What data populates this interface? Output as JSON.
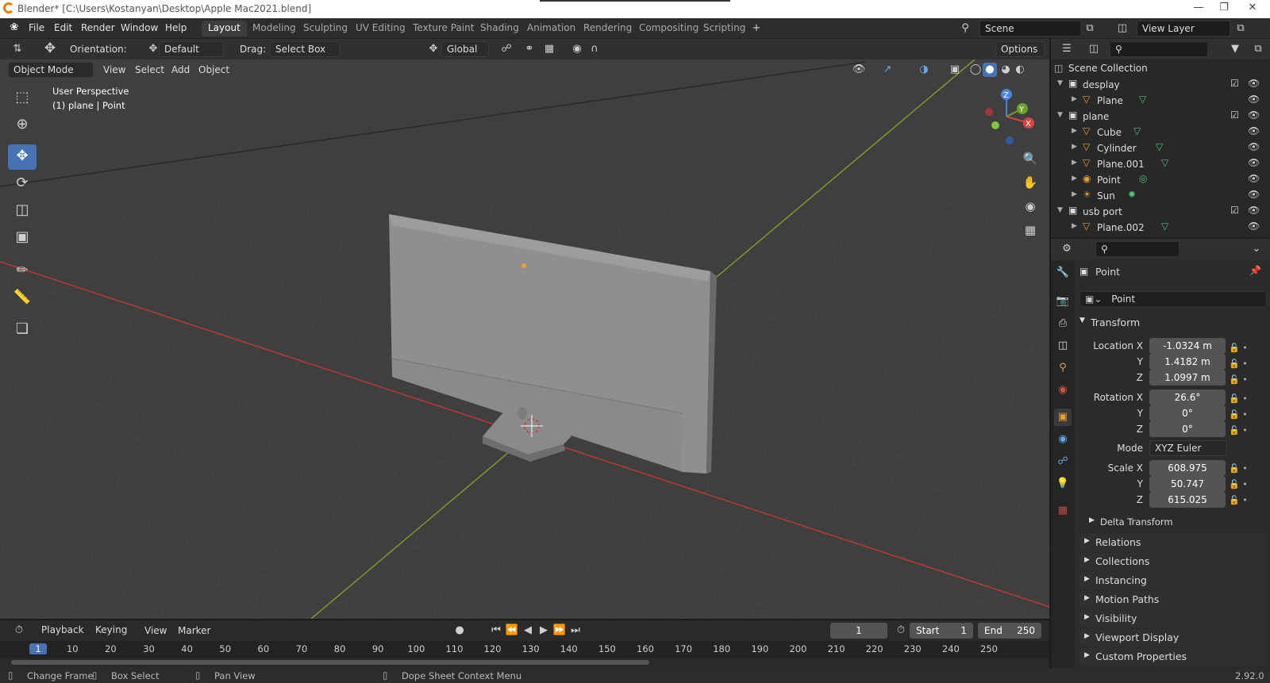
{
  "window": {
    "title": "Blender* [C:\\Users\\Kostanyan\\Desktop\\Apple Mac2021.blend]"
  },
  "menu": [
    "File",
    "Edit",
    "Render",
    "Window",
    "Help"
  ],
  "workspaces": [
    "Layout",
    "Modeling",
    "Sculpting",
    "UV Editing",
    "Texture Paint",
    "Shading",
    "Animation",
    "Rendering",
    "Compositing",
    "Scripting"
  ],
  "scene": {
    "label": "Scene",
    "view_layer": "View Layer"
  },
  "header": {
    "orientation_label": "Orientation:",
    "orientation": "Default",
    "drag_label": "Drag:",
    "drag": "Select Box",
    "transform": "Global",
    "options": "Options"
  },
  "vp_header": {
    "mode": "Object Mode",
    "menus": [
      "View",
      "Select",
      "Add",
      "Object"
    ]
  },
  "viewport": {
    "perspective": "User Perspective",
    "object_info": "(1) plane | Point"
  },
  "gizmo": {
    "x": "X",
    "y": "Y",
    "z": "Z"
  },
  "outliner": {
    "root": "Scene Collection",
    "rows": [
      {
        "name": "desplay",
        "kind": "collection",
        "depth": 1
      },
      {
        "name": "Plane",
        "kind": "mesh",
        "depth": 2
      },
      {
        "name": "plane",
        "kind": "collection",
        "depth": 1
      },
      {
        "name": "Cube",
        "kind": "mesh",
        "depth": 2
      },
      {
        "name": "Cylinder",
        "kind": "mesh",
        "depth": 2
      },
      {
        "name": "Plane.001",
        "kind": "mesh",
        "depth": 2
      },
      {
        "name": "Point",
        "kind": "light",
        "depth": 2
      },
      {
        "name": "Sun",
        "kind": "sun",
        "depth": 2
      },
      {
        "name": "usb port",
        "kind": "collection",
        "depth": 1
      },
      {
        "name": "Plane.002",
        "kind": "mesh",
        "depth": 2
      }
    ]
  },
  "properties": {
    "object_name": "Point",
    "datablock": "Point",
    "transform_label": "Transform",
    "location_label": "Location X",
    "location": [
      "-1.0324 m",
      "1.4182 m",
      "1.0997 m"
    ],
    "rotation_label": "Rotation X",
    "rotation": [
      "26.6°",
      "0°",
      "0°"
    ],
    "mode_label": "Mode",
    "mode": "XYZ Euler",
    "scale_label": "Scale X",
    "scale": [
      "608.975",
      "50.747",
      "615.025"
    ],
    "axis_y": "Y",
    "axis_z": "Z",
    "delta": "Delta Transform",
    "panels": [
      "Relations",
      "Collections",
      "Instancing",
      "Motion Paths",
      "Visibility",
      "Viewport Display",
      "Custom Properties"
    ]
  },
  "timeline": {
    "menus": [
      "Playback",
      "Keying",
      "View",
      "Marker"
    ],
    "current": "1",
    "start_label": "Start",
    "start": "1",
    "end_label": "End",
    "end": "250",
    "ticks": [
      "1",
      "10",
      "20",
      "30",
      "40",
      "50",
      "60",
      "70",
      "80",
      "90",
      "100",
      "110",
      "120",
      "130",
      "140",
      "150",
      "160",
      "170",
      "180",
      "190",
      "200",
      "210",
      "220",
      "230",
      "240",
      "250"
    ]
  },
  "status": {
    "items": [
      "Change Frame",
      "Box Select",
      "Pan View",
      "Dope Sheet Context Menu"
    ],
    "version": "2.92.0"
  },
  "colors": {
    "accent": "#4772b3",
    "orange": "#e87d0d",
    "grid_red": "#b83a3a",
    "grid_green": "#7a9a2a"
  }
}
